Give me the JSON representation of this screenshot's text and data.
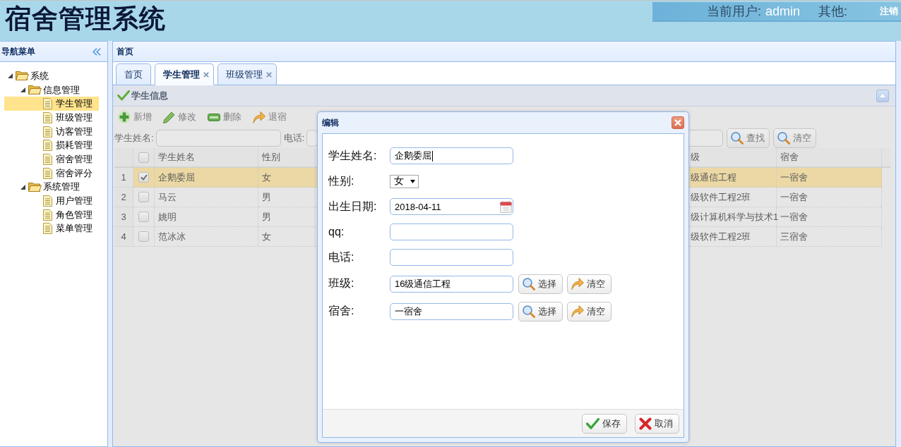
{
  "header": {
    "title": "宿舍管理系统",
    "user_label": "当前用户:",
    "user_name": "admin",
    "other_label": "其他:",
    "logout": "注销"
  },
  "sidebar": {
    "title": "导航菜单",
    "tree": [
      {
        "label": "系统",
        "expanded": true,
        "selected": false,
        "children": [
          {
            "label": "信息管理",
            "expanded": true,
            "selected": false,
            "children": [
              {
                "label": "学生管理",
                "selected": true
              },
              {
                "label": "班级管理",
                "selected": false
              },
              {
                "label": "访客管理",
                "selected": false
              },
              {
                "label": "损耗管理",
                "selected": false
              },
              {
                "label": "宿舍管理",
                "selected": false
              },
              {
                "label": "宿舍评分",
                "selected": false
              }
            ]
          },
          {
            "label": "系统管理",
            "expanded": true,
            "selected": false,
            "children": [
              {
                "label": "用户管理",
                "selected": false
              },
              {
                "label": "角色管理",
                "selected": false
              },
              {
                "label": "菜单管理",
                "selected": false
              }
            ]
          }
        ]
      }
    ]
  },
  "main": {
    "title": "首页",
    "tabs": [
      {
        "label": "首页",
        "closable": false,
        "selected": false
      },
      {
        "label": "学生管理",
        "closable": true,
        "selected": true
      },
      {
        "label": "班级管理",
        "closable": true,
        "selected": false
      }
    ]
  },
  "student_panel": {
    "title": "学生信息",
    "toolbar": [
      {
        "label": "新增",
        "kind": "add"
      },
      {
        "label": "修改",
        "kind": "edit"
      },
      {
        "label": "删除",
        "kind": "remove"
      },
      {
        "label": "退宿",
        "kind": "undo"
      }
    ],
    "search": {
      "fields": [
        {
          "label": "学生姓名:"
        },
        {
          "label": "电话:"
        }
      ],
      "buttons": [
        {
          "label": "查找"
        },
        {
          "label": "清空"
        }
      ]
    },
    "table": {
      "select_all": {
        "checked": false
      },
      "columns": [
        "学生姓名",
        "性别",
        "级",
        "宿舍"
      ],
      "rows": [
        {
          "number": "1",
          "checked": true,
          "selected": true,
          "cells": [
            "企鹅委屈",
            "女",
            "级通信工程",
            "一宿舍"
          ]
        },
        {
          "number": "2",
          "checked": false,
          "selected": false,
          "cells": [
            "马云",
            "男",
            "级软件工程2班",
            "一宿舍"
          ]
        },
        {
          "number": "3",
          "checked": false,
          "selected": false,
          "cells": [
            "姚明",
            "男",
            "级计算机科学与技术1",
            "一宿舍"
          ]
        },
        {
          "number": "4",
          "checked": false,
          "selected": false,
          "cells": [
            "范冰冰",
            "女",
            "级软件工程2班",
            "三宿舍"
          ]
        }
      ]
    }
  },
  "dialog": {
    "title": "编辑",
    "fields": [
      {
        "label": "学生姓名:",
        "kind": "text",
        "value": "企鹅委屈",
        "focused": true
      },
      {
        "label": "性别:",
        "kind": "select",
        "value": "女"
      },
      {
        "label": "出生日期:",
        "kind": "date",
        "value": "2018-04-11"
      },
      {
        "label": "qq:",
        "kind": "text",
        "focused": false
      },
      {
        "label": "电话:",
        "kind": "text",
        "focused": false
      },
      {
        "label": "班级:",
        "kind": "picker",
        "value": "16级通信工程",
        "buttons": [
          {
            "label": "选择",
            "kind": "search"
          },
          {
            "label": "清空",
            "kind": "clear"
          }
        ]
      },
      {
        "label": "宿舍:",
        "kind": "picker",
        "value": "一宿舍",
        "buttons": [
          {
            "label": "选择",
            "kind": "search"
          },
          {
            "label": "清空",
            "kind": "clear"
          }
        ]
      }
    ],
    "buttons": [
      {
        "label": "保存",
        "kind": "save"
      },
      {
        "label": "取消",
        "kind": "cancel"
      }
    ]
  }
}
